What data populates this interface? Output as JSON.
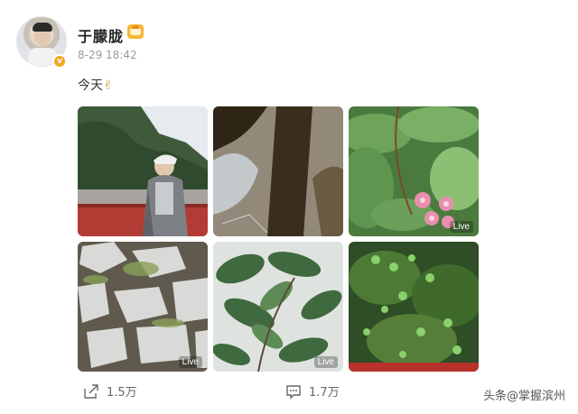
{
  "author": {
    "name": "于朦胧",
    "verified": true
  },
  "post": {
    "time": "8-29 18:42",
    "text": "今天",
    "emoji": "✌"
  },
  "media": [
    {
      "id": 1,
      "live": false
    },
    {
      "id": 2,
      "live": false
    },
    {
      "id": 3,
      "live": true,
      "live_label": "Live"
    },
    {
      "id": 4,
      "live": true,
      "live_label": "Live"
    },
    {
      "id": 5,
      "live": true,
      "live_label": "Live"
    },
    {
      "id": 6,
      "live": false
    }
  ],
  "actions": {
    "share_count": "1.5万",
    "comment_count": "1.7万"
  },
  "watermark": "头条@掌握滨州",
  "icons": {
    "share": "share-icon",
    "comment": "comment-icon",
    "verified": "verified-icon",
    "badge": "fan-badge-icon"
  },
  "colors": {
    "verified": "#f5a623",
    "badge": "#f7b733"
  }
}
